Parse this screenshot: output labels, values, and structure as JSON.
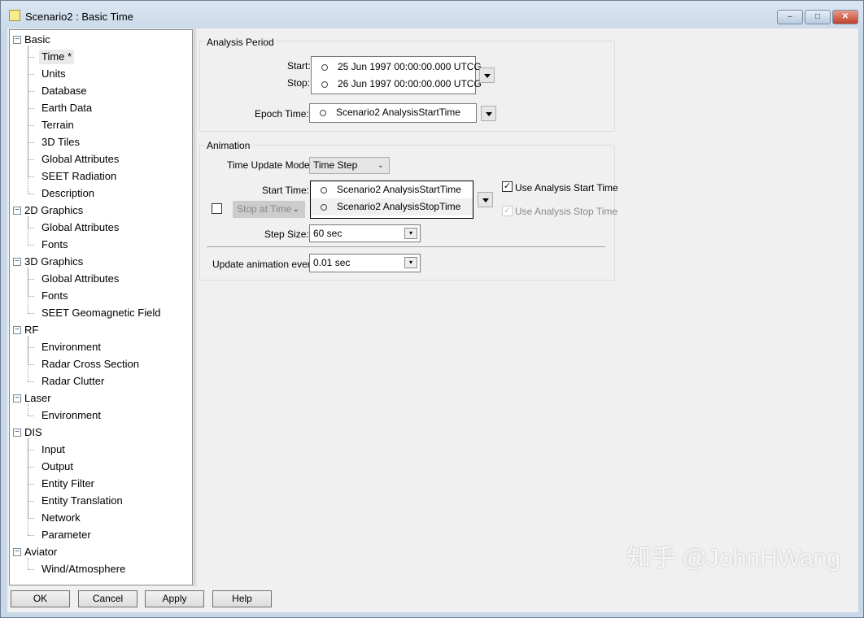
{
  "window": {
    "title": "Scenario2 : Basic Time",
    "minimize": "–",
    "maximize": "□",
    "close": "✕"
  },
  "tree": [
    {
      "label": "Basic",
      "level": 0
    },
    {
      "label": "Time *",
      "level": 1,
      "selected": true
    },
    {
      "label": "Units",
      "level": 1
    },
    {
      "label": "Database",
      "level": 1
    },
    {
      "label": "Earth Data",
      "level": 1
    },
    {
      "label": "Terrain",
      "level": 1
    },
    {
      "label": "3D Tiles",
      "level": 1
    },
    {
      "label": "Global Attributes",
      "level": 1
    },
    {
      "label": "SEET Radiation",
      "level": 1
    },
    {
      "label": "Description",
      "level": 1
    },
    {
      "label": "2D Graphics",
      "level": 0
    },
    {
      "label": "Global Attributes",
      "level": 1
    },
    {
      "label": "Fonts",
      "level": 1
    },
    {
      "label": "3D Graphics",
      "level": 0
    },
    {
      "label": "Global Attributes",
      "level": 1
    },
    {
      "label": "Fonts",
      "level": 1
    },
    {
      "label": "SEET Geomagnetic Field",
      "level": 1
    },
    {
      "label": "RF",
      "level": 0
    },
    {
      "label": "Environment",
      "level": 1
    },
    {
      "label": "Radar Cross Section",
      "level": 1
    },
    {
      "label": "Radar Clutter",
      "level": 1
    },
    {
      "label": "Laser",
      "level": 0
    },
    {
      "label": "Environment",
      "level": 1
    },
    {
      "label": "DIS",
      "level": 0
    },
    {
      "label": "Input",
      "level": 1
    },
    {
      "label": "Output",
      "level": 1
    },
    {
      "label": "Entity Filter",
      "level": 1
    },
    {
      "label": "Entity Translation",
      "level": 1
    },
    {
      "label": "Network",
      "level": 1
    },
    {
      "label": "Parameter",
      "level": 1
    },
    {
      "label": "Aviator",
      "level": 0
    },
    {
      "label": "Wind/Atmosphere",
      "level": 1
    }
  ],
  "analysis": {
    "title": "Analysis Period",
    "start_label": "Start:",
    "start": "25 Jun 1997 00:00:00.000 UTCG",
    "stop_label": "Stop:",
    "stop": "26 Jun 1997 00:00:00.000 UTCG",
    "epoch_label": "Epoch Time:",
    "epoch": "Scenario2 AnalysisStartTime"
  },
  "animation": {
    "title": "Animation",
    "mode_label": "Time Update Mode:",
    "mode": "Time Step",
    "start_label": "Start Time:",
    "start": "Scenario2 AnalysisStartTime",
    "stop": "Scenario2 AnalysisStopTime",
    "stop_mode": "Stop at Time",
    "stop_enabled": false,
    "use_start_label": "Use Analysis Start Time",
    "use_start": true,
    "use_stop_label": "Use Analysis Stop Time",
    "use_stop": true,
    "step_label": "Step Size:",
    "step": "60 sec",
    "update_label": "Update animation every:",
    "update": "0.01 sec"
  },
  "buttons": {
    "ok": "OK",
    "cancel": "Cancel",
    "apply": "Apply",
    "help": "Help"
  },
  "watermark": "知乎 @JohnHWang"
}
